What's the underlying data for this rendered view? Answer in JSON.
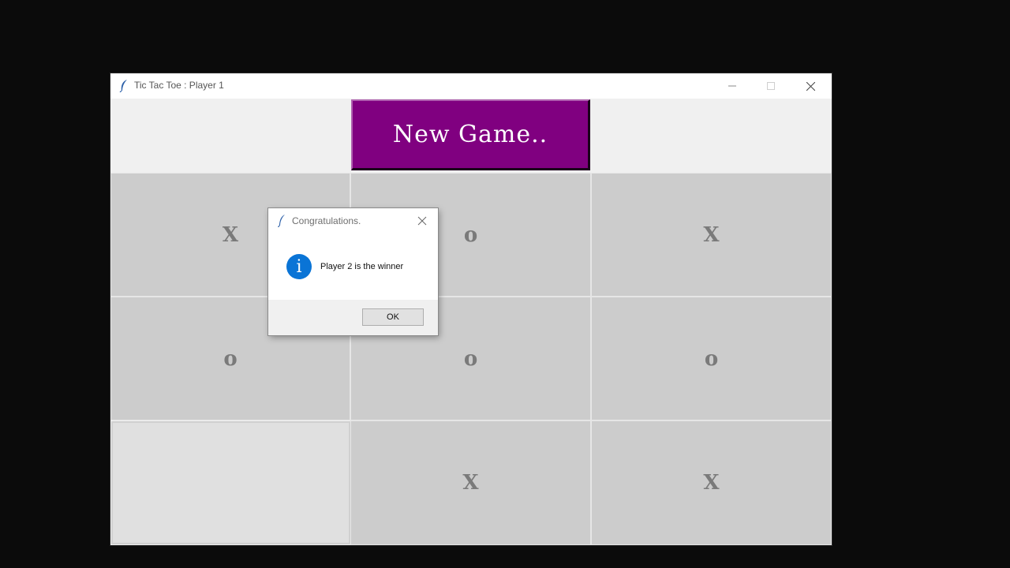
{
  "window": {
    "title": "Tic Tac Toe : Player 1"
  },
  "toolbar": {
    "new_game_label": "New Game.."
  },
  "board": {
    "cells": [
      "X",
      "o",
      "X",
      "o",
      "o",
      "o",
      "",
      "X",
      "X"
    ]
  },
  "dialog": {
    "title": "Congratulations.",
    "message": "Player 2 is the winner",
    "ok_label": "OK",
    "icon": "info-icon"
  },
  "colors": {
    "new_game_button": "#800080",
    "cell_background": "#cccccc",
    "mark_color": "#7a7a7a",
    "info_icon": "#0a74d6"
  }
}
